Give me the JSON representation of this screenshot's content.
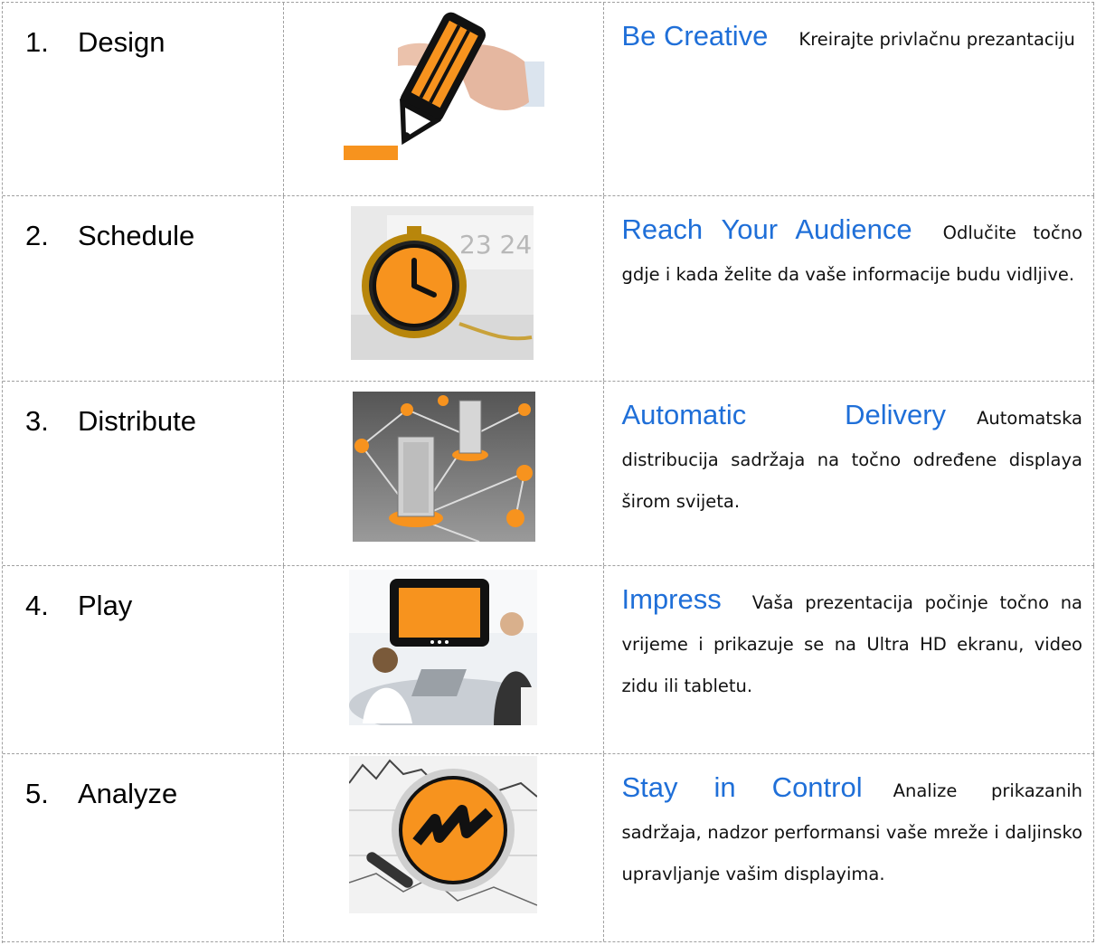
{
  "rows": [
    {
      "num": "1.",
      "title": "Design",
      "heading": "Be Creative",
      "text": "Kreirajte privlačnu prezantaciju",
      "icon": "pencil-hand-icon"
    },
    {
      "num": "2.",
      "title": "Schedule",
      "heading": "Reach Your Audience",
      "text": "Odlučite točno gdje i kada želite da vaše informacije budu vidljive.",
      "icon": "pocket-watch-calendar-icon"
    },
    {
      "num": "3.",
      "title": "Distribute",
      "heading": "Automatic Delivery",
      "text": "Automatska distribucija sadržaja na točno određene displaya širom svijeta.",
      "icon": "network-servers-icon"
    },
    {
      "num": "4.",
      "title": "Play",
      "heading": "Impress",
      "text": "Vaša prezentacija počinje točno na vrijeme i prikazuje se na Ultra HD ekranu, video zidu ili tabletu.",
      "icon": "meeting-screen-icon"
    },
    {
      "num": "5.",
      "title": "Analyze",
      "heading": "Stay in Control",
      "text": "Analize prikazanih sadržaja, nadzor performansi vaše mreže i daljinsko upravljanje vašim displayima.",
      "icon": "magnifier-chart-icon"
    }
  ],
  "colors": {
    "accent": "#f7931e",
    "heading": "#1f6fd8"
  }
}
